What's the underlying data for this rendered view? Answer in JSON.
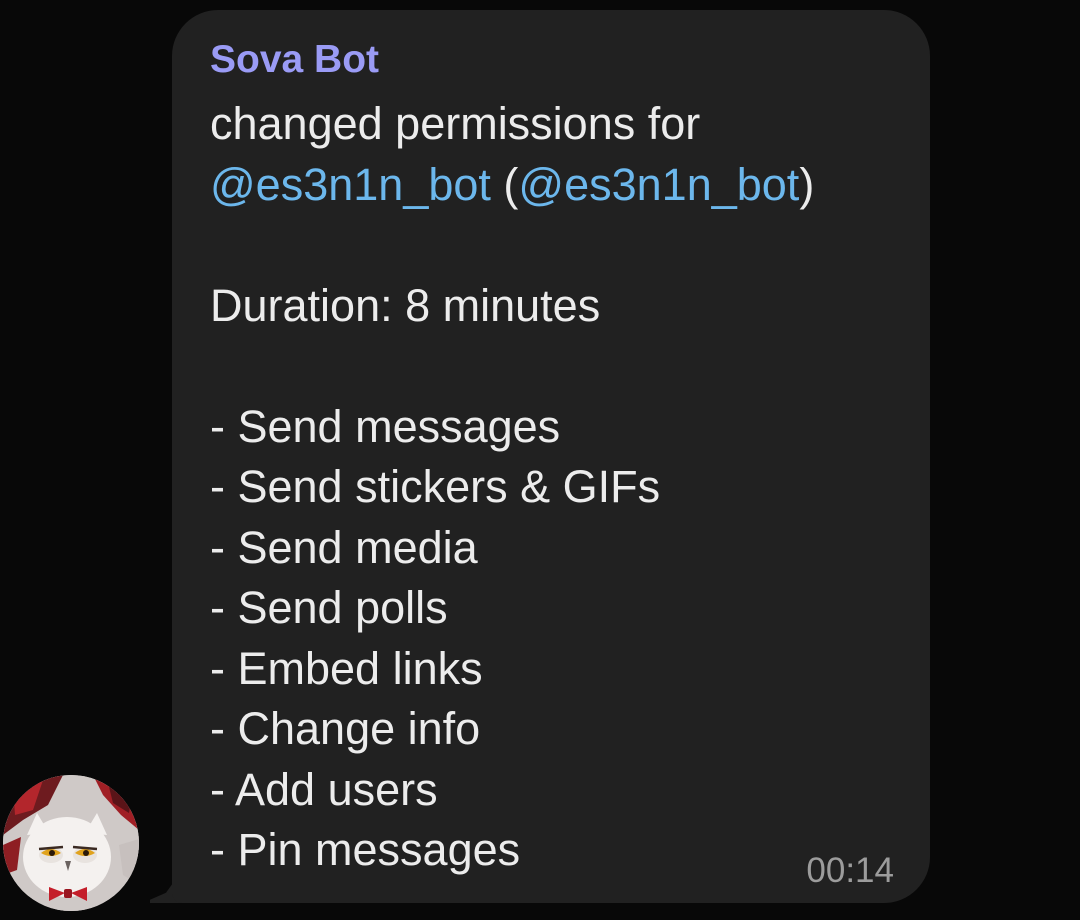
{
  "message": {
    "sender": "Sova Bot",
    "intro": "changed permissions for",
    "mention_primary": "@es3n1n_bot",
    "paren_open": " (",
    "mention_secondary": "@es3n1n_bot",
    "paren_close": ")",
    "duration": "Duration: 8 minutes",
    "permissions": [
      "- Send messages",
      "- Send stickers & GIFs",
      "- Send media",
      "- Send polls",
      "- Embed links",
      "- Change info",
      "- Add users",
      "- Pin messages"
    ],
    "time": "00:14"
  },
  "colors": {
    "background": "#080808",
    "bubble": "#212121",
    "sender": "#9a9bf5",
    "mention": "#6cb7ec",
    "text": "#ececec",
    "time": "#9c9c9c"
  },
  "avatar": {
    "icon": "owl-avatar-icon"
  }
}
